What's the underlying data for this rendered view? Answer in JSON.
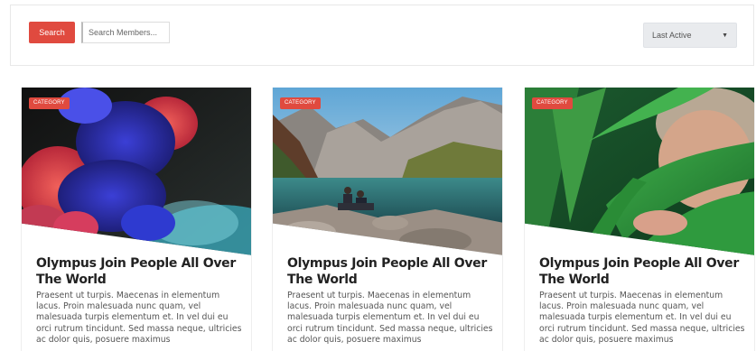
{
  "filter_bar": {
    "search_label": "Search",
    "search_placeholder": "Search Members...",
    "sort_selected": "Last Active",
    "sort_arrow_icon": "caret-down-icon"
  },
  "cards": [
    {
      "category": "CATEGORY",
      "title": "Olympus Join People All Over The World",
      "excerpt": "Praesent ut turpis. Maecenas in elementum lacus. Proin malesuada nunc quam, vel malesuada turpis elementum et. In vel dui eu orci rutrum tincidunt. Sed massa neque, ultricies ac dolor quis, posuere maximus",
      "image": "colorful-smoke"
    },
    {
      "category": "CATEGORY",
      "title": "Olympus Join People All Over The World",
      "excerpt": "Praesent ut turpis. Maecenas in elementum lacus. Proin malesuada nunc quam, vel malesuada turpis elementum et. In vel dui eu orci rutrum tincidunt. Sed massa neque, ultricies ac dolor quis, posuere maximus",
      "image": "mountain-lake"
    },
    {
      "category": "CATEGORY",
      "title": "Olympus Join People All Over The World",
      "excerpt": "Praesent ut turpis. Maecenas in elementum lacus. Proin malesuada nunc quam, vel malesuada turpis elementum et. In vel dui eu orci rutrum tincidunt. Sed massa neque, ultricies ac dolor quis, posuere maximus",
      "image": "woman-leaves"
    }
  ],
  "colors": {
    "accent": "#e04a3f",
    "select_bg": "#e9ebee"
  }
}
